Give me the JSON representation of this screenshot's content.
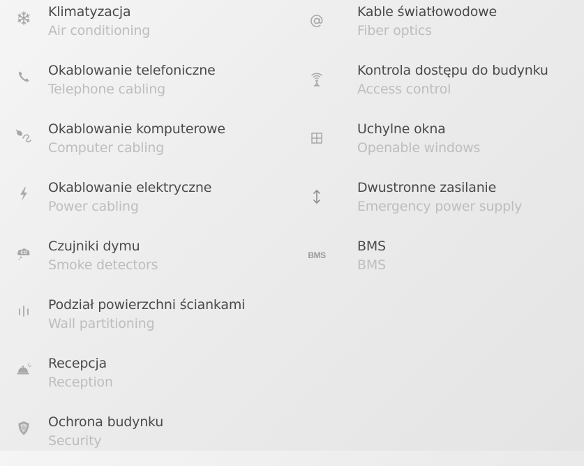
{
  "features_left": [
    {
      "title": "Klimatyzacja",
      "subtitle": "Air conditioning",
      "icon": "snowflake-icon"
    },
    {
      "title": "Okablowanie telefoniczne",
      "subtitle": "Telephone cabling",
      "icon": "phone-icon"
    },
    {
      "title": "Okablowanie komputerowe",
      "subtitle": "Computer cabling",
      "icon": "mouse-cable-icon"
    },
    {
      "title": "Okablowanie elektryczne",
      "subtitle": "Power cabling",
      "icon": "lightning-icon"
    },
    {
      "title": "Czujniki dymu",
      "subtitle": "Smoke detectors",
      "icon": "co-cloud-icon"
    },
    {
      "title": "Podział powierzchni ściankami",
      "subtitle": "Wall partitioning",
      "icon": "partition-icon"
    },
    {
      "title": "Recepcja",
      "subtitle": "Reception",
      "icon": "reception-bell-icon"
    },
    {
      "title": "Ochrona budynku",
      "subtitle": "Security",
      "icon": "shield-icon"
    }
  ],
  "features_right": [
    {
      "title": "Kable światłowodowe",
      "subtitle": "Fiber optics",
      "icon": "at-sign-icon"
    },
    {
      "title": "Kontrola dostępu do budynku",
      "subtitle": "Access control",
      "icon": "antenna-icon"
    },
    {
      "title": "Uchylne okna",
      "subtitle": "Openable windows",
      "icon": "window-icon"
    },
    {
      "title": "Dwustronne zasilanie",
      "subtitle": "Emergency power supply",
      "icon": "updown-arrow-icon"
    },
    {
      "title": "BMS",
      "subtitle": "BMS",
      "icon": "bms-icon",
      "icon_text": "BMS"
    }
  ],
  "colors": {
    "title": "#4a4a4a",
    "subtitle": "#bdbdbd",
    "icon": "#a8a8a8"
  }
}
